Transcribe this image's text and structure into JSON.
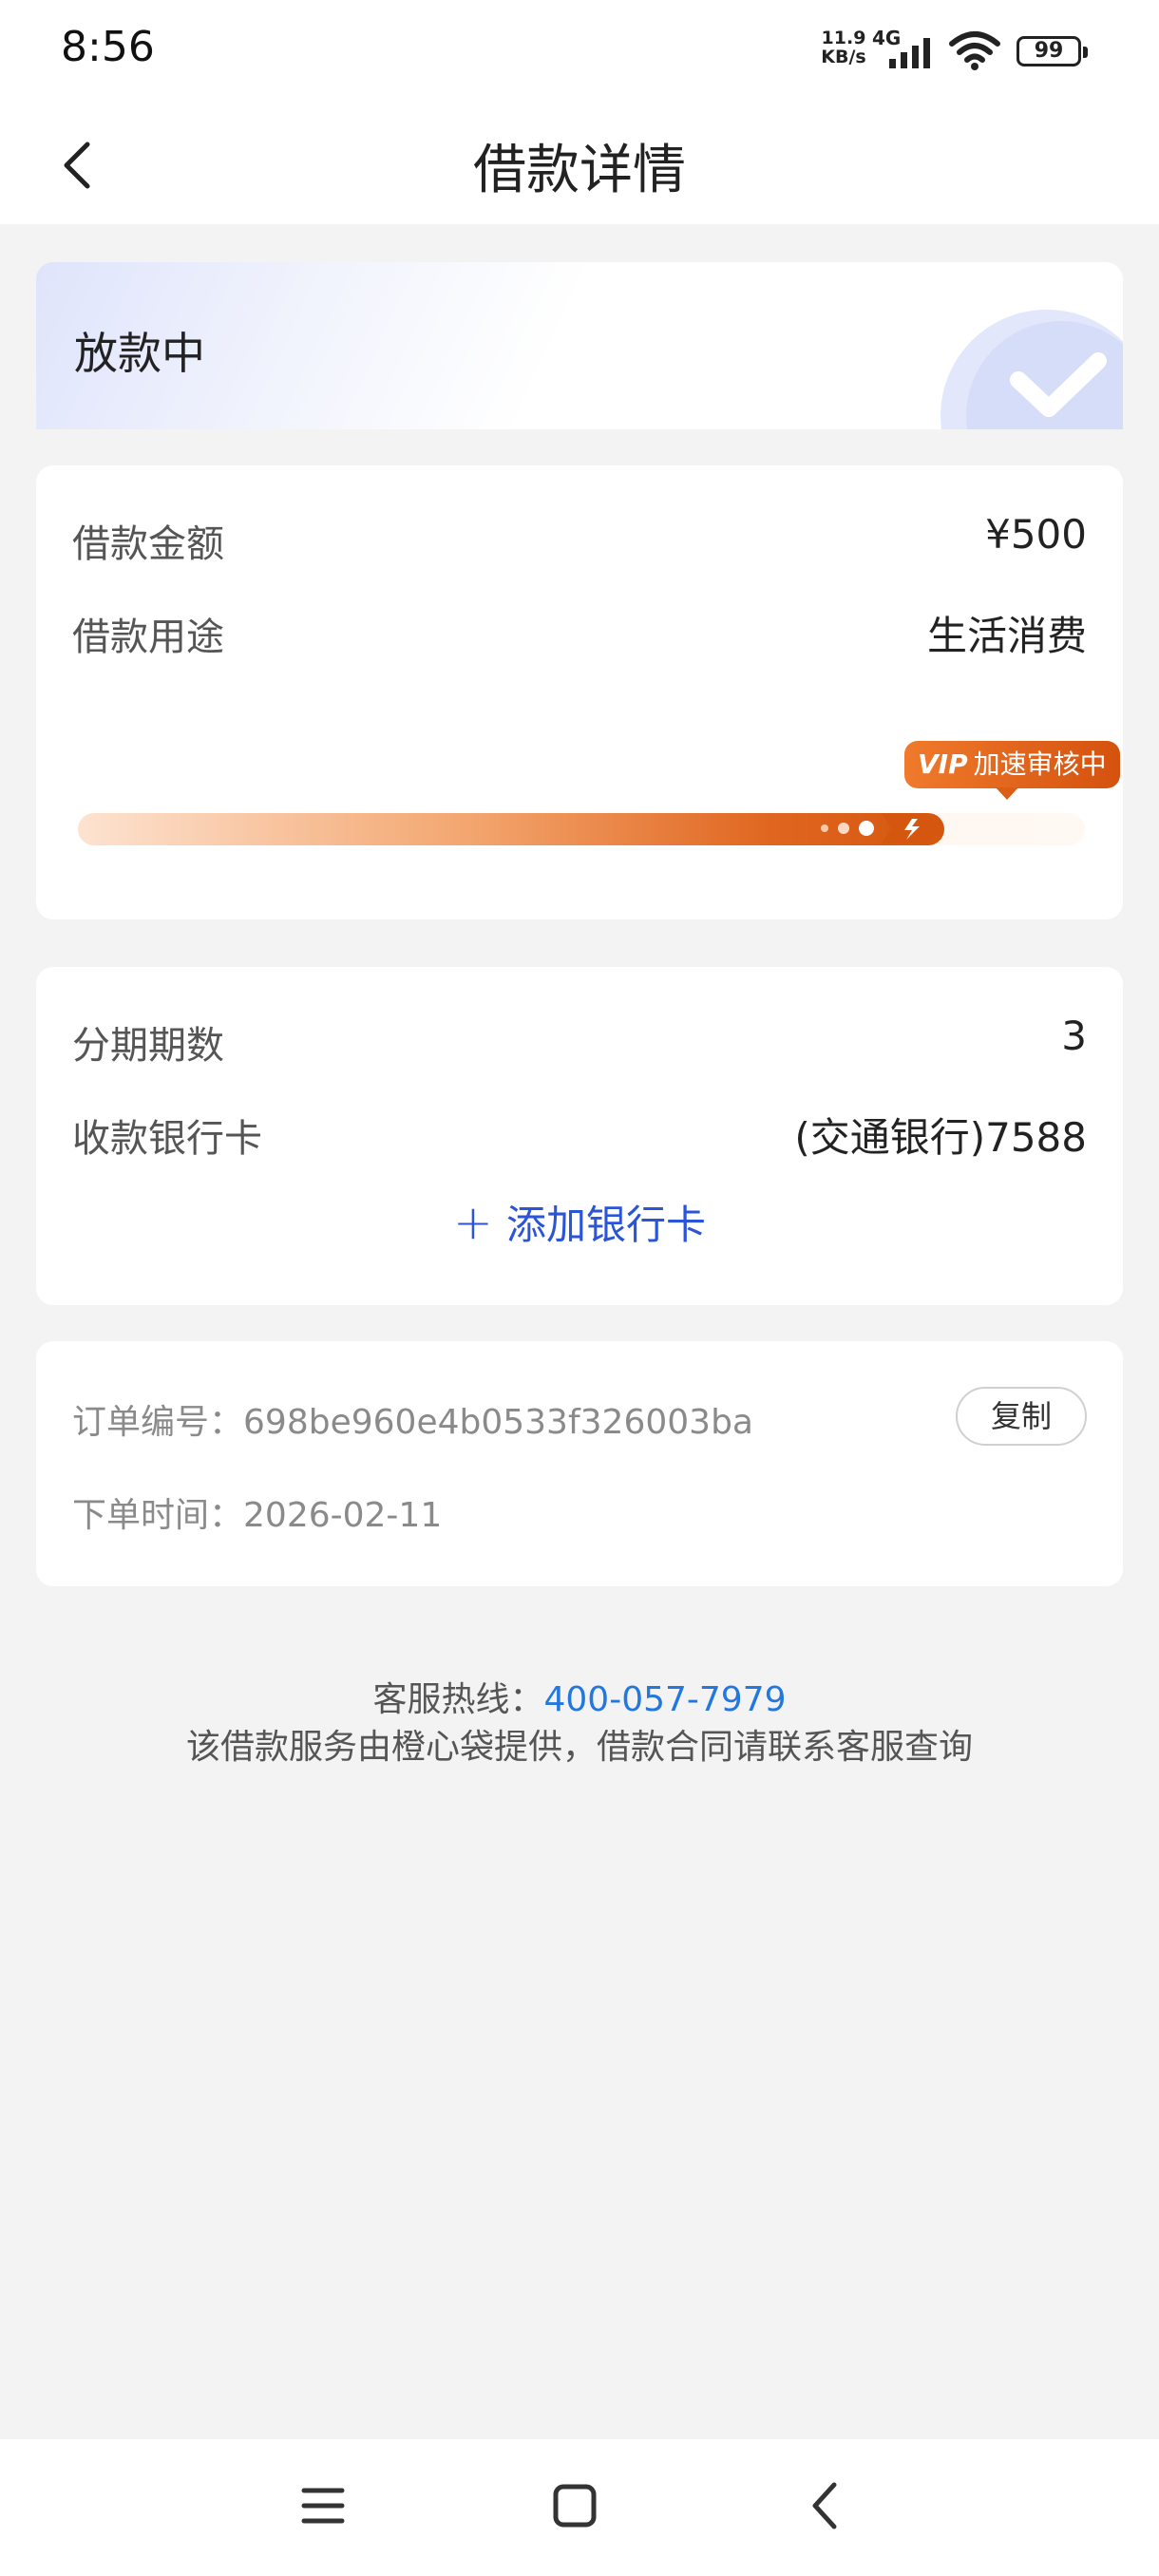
{
  "status_bar": {
    "time": "8:56",
    "net_speed_value": "11.9",
    "net_speed_unit": "KB/s",
    "network_type": "4G",
    "battery": "99"
  },
  "header": {
    "title": "借款详情"
  },
  "loan_status": {
    "label": "放款中"
  },
  "loan_info": {
    "amount_label": "借款金额",
    "amount_value": "¥500",
    "purpose_label": "借款用途",
    "purpose_value": "生活消费",
    "progress_badge_vip": "VIP",
    "progress_badge_text": "加速审核中",
    "progress_fraction": 0.86
  },
  "installment_info": {
    "periods_label": "分期期数",
    "periods_value": "3",
    "bank_card_label": "收款银行卡",
    "bank_card_value": "(交通银行)7588",
    "add_card_label": "添加银行卡"
  },
  "order_info": {
    "order_no_label": "订单编号：",
    "order_no_value": "698be960e4b0533f326003ba",
    "copy_label": "复制",
    "order_time_label": "下单时间：",
    "order_time_value": "2026-02-11"
  },
  "footer": {
    "hotline_label": "客服热线：",
    "hotline_number": "400-057-7979",
    "disclaimer": "该借款服务由橙心袋提供，借款合同请联系客服查询"
  },
  "colors": {
    "accent_blue": "#2a55d8",
    "hotline_blue": "#2378e0",
    "progress_orange": "#d5560f",
    "background": "#f3f3f3"
  }
}
